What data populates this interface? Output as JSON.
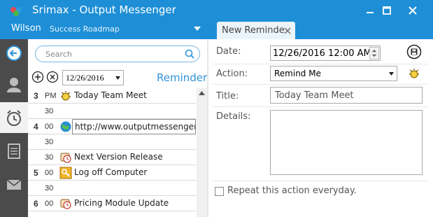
{
  "window": {
    "title": "Srimax - Output Messenger",
    "user_name": "Wilson",
    "user_status": "Success Roadmap"
  },
  "tab": {
    "label": "New Reminde"
  },
  "search": {
    "placeholder": "Search"
  },
  "toolbar": {
    "date": "12/26/2016",
    "heading": "Reminder"
  },
  "schedule": {
    "slots": [
      {
        "hour": "3",
        "min": "PM",
        "text": "Today Team Meet",
        "icon": "alarm-icon"
      },
      {
        "hour": "",
        "min": "30",
        "text": ""
      },
      {
        "hour": "4",
        "min": "00",
        "text": "http://www.outputmessenger.co",
        "icon": "globe-icon"
      },
      {
        "hour": "",
        "min": "30",
        "text": ""
      },
      {
        "hour": "",
        "min": "30",
        "text": "Next Version Release",
        "icon": "message-clock-icon"
      },
      {
        "hour": "5",
        "min": "00",
        "text": "Log off Computer",
        "icon": "key-icon"
      },
      {
        "hour": "",
        "min": "30",
        "text": ""
      },
      {
        "hour": "6",
        "min": "00",
        "text": "Pricing Module Update",
        "icon": "message-clock-icon"
      }
    ]
  },
  "form": {
    "date_label": "Date:",
    "date_value": "12/26/2016  12:00 AM",
    "action_label": "Action:",
    "action_value": "Remind Me",
    "title_label": "Title:",
    "title_value": "Today Team Meet",
    "details_label": "Details:",
    "details_value": "",
    "repeat_label": "Repeat this action everyday.",
    "repeat_checked": false
  },
  "colors": {
    "titlebar": "#1e8fd6",
    "nav": "#4b4b4b",
    "accent": "#2f93d8"
  }
}
